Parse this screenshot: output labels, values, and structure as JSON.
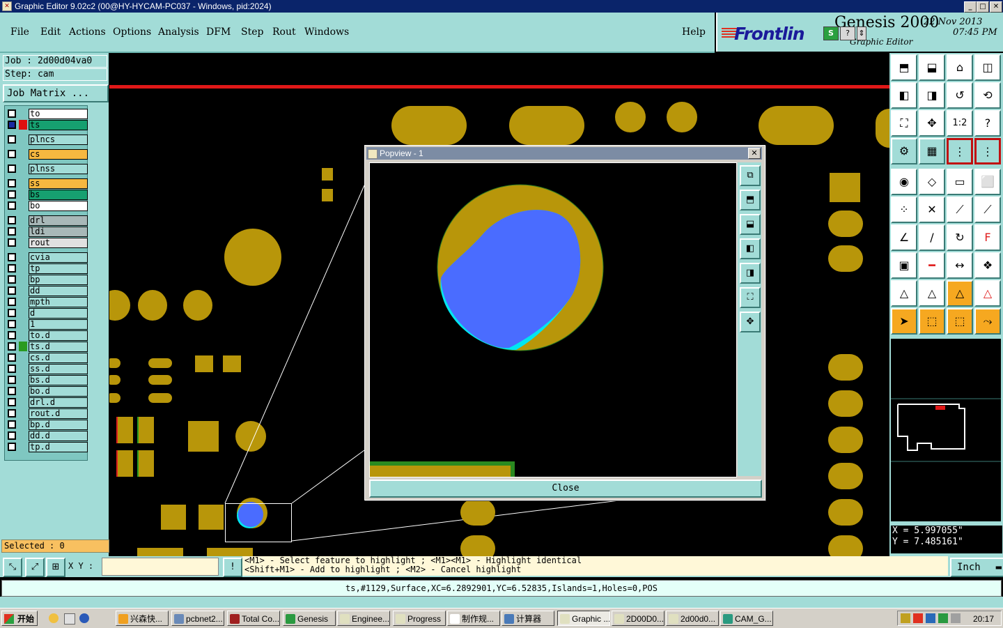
{
  "window": {
    "title": "Graphic Editor 9.02c2 (00@HY-HYCAM-PC037 - Windows, pid:2024)"
  },
  "menu": [
    "File",
    "Edit",
    "Actions",
    "Options",
    "Analysis",
    "DFM",
    "Step",
    "Rout",
    "Windows"
  ],
  "help_label": "Help",
  "brand": {
    "logo": "Frontlin",
    "product": "Genesis 2000",
    "subtitle": "Graphic Editor",
    "date": "22 Nov 2013",
    "time": "07:45 PM"
  },
  "job": {
    "job_label": "Job : 2d00d04va0",
    "step_label": "Step: cam",
    "matrix_button": "Job Matrix ..."
  },
  "layers": [
    {
      "name": "to",
      "color": "#ffffff"
    },
    {
      "name": "ts",
      "color": "#16a070"
    },
    {
      "name": "plncs",
      "color": "#a2dcd7"
    },
    {
      "name": "cs",
      "color": "#f6b840"
    },
    {
      "name": "plnss",
      "color": "#a2dcd7"
    },
    {
      "name": "ss",
      "color": "#f6b840"
    },
    {
      "name": "bs",
      "color": "#16a070"
    },
    {
      "name": "bo",
      "color": "#ffffff"
    },
    {
      "name": "drl",
      "color": "#a8b8b8"
    },
    {
      "name": "ldi",
      "color": "#a8b8b8"
    },
    {
      "name": "rout",
      "color": "#e0e0e0"
    },
    {
      "name": "cvia",
      "color": "#a2dcd7"
    },
    {
      "name": "tp",
      "color": "#a2dcd7"
    },
    {
      "name": "bp",
      "color": "#a2dcd7"
    },
    {
      "name": "dd",
      "color": "#a2dcd7"
    },
    {
      "name": "mpth",
      "color": "#a2dcd7"
    },
    {
      "name": "d",
      "color": "#a2dcd7"
    },
    {
      "name": "1",
      "color": "#a2dcd7"
    },
    {
      "name": "to.d",
      "color": "#a2dcd7"
    },
    {
      "name": "ts.d",
      "color": "#a2dcd7"
    },
    {
      "name": "cs.d",
      "color": "#a2dcd7"
    },
    {
      "name": "ss.d",
      "color": "#a2dcd7"
    },
    {
      "name": "bs.d",
      "color": "#a2dcd7"
    },
    {
      "name": "bo.d",
      "color": "#a2dcd7"
    },
    {
      "name": "drl.d",
      "color": "#a2dcd7"
    },
    {
      "name": "rout.d",
      "color": "#a2dcd7"
    },
    {
      "name": "bp.d",
      "color": "#a2dcd7"
    },
    {
      "name": "dd.d",
      "color": "#a2dcd7"
    },
    {
      "name": "tp.d",
      "color": "#a2dcd7"
    }
  ],
  "selected_label": "Selected : 0",
  "popview": {
    "title": "Popview - 1",
    "close_label": "Close"
  },
  "coords": {
    "x": "X = 5.997055\"",
    "y": "Y = 7.485161\""
  },
  "cmd": {
    "xy_label": "X Y :",
    "hint_line1": "<M1> - Select feature to highlight ; <M1><M1> - Highlight identical",
    "hint_line2": "<Shift+M1> - Add to highlight ; <M2> - Cancel highlight",
    "unit": "Inch"
  },
  "info": "ts,#1129,Surface,XC=6.2892901,YC=6.52835,Islands=1,Holes=0,POS",
  "taskbar": {
    "start": "开始",
    "tasks": [
      "兴森快...",
      "pcbnet2...",
      "Total Co...",
      "Genesis",
      "Enginee...",
      "Progress",
      "制作规...",
      "计算器",
      "Graphic ...",
      "2D00D0...",
      "2d00d0...",
      "CAM_G..."
    ],
    "clock": "20:17"
  },
  "colors": {
    "teal_panel": "#a2dcd7",
    "copper": "#b8960a",
    "surface_blue": "#4a6cff",
    "cyan": "#00e6f0"
  }
}
